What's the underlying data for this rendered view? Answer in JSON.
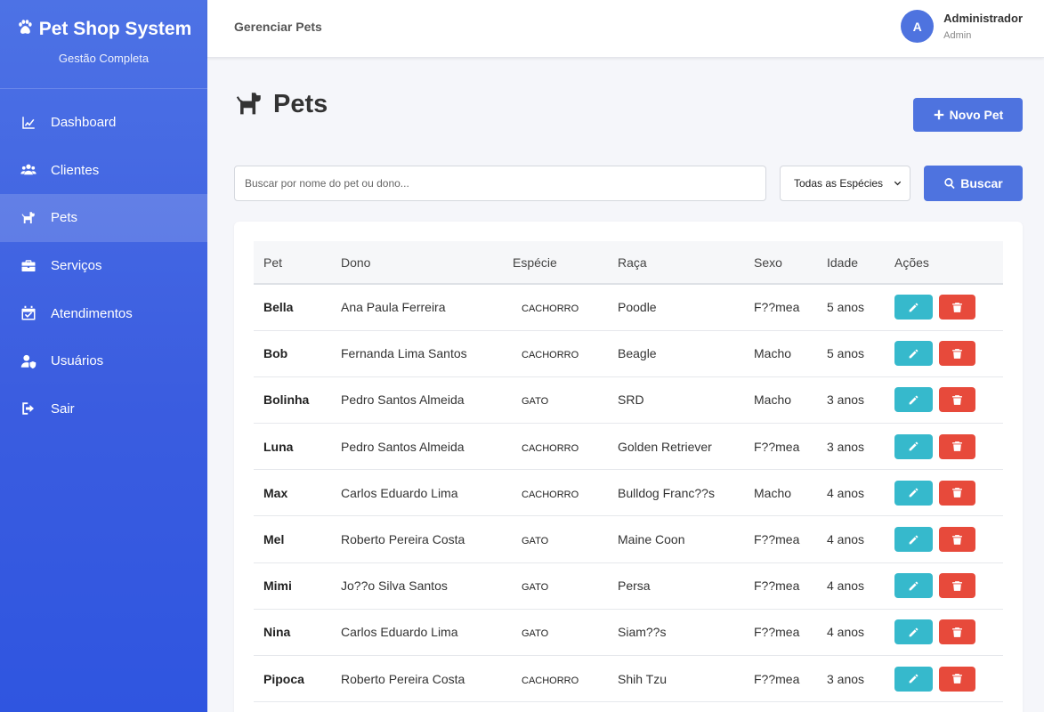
{
  "brand": {
    "title": "Pet Shop System",
    "subtitle": "Gestão Completa"
  },
  "sidebar": {
    "items": [
      {
        "label": "Dashboard",
        "icon": "chart-line-icon"
      },
      {
        "label": "Clientes",
        "icon": "users-icon"
      },
      {
        "label": "Pets",
        "icon": "dog-icon",
        "active": true
      },
      {
        "label": "Serviços",
        "icon": "briefcase-icon"
      },
      {
        "label": "Atendimentos",
        "icon": "calendar-check-icon"
      },
      {
        "label": "Usuários",
        "icon": "user-shield-icon"
      },
      {
        "label": "Sair",
        "icon": "sign-out-icon"
      }
    ]
  },
  "topbar": {
    "title": "Gerenciar Pets",
    "user": {
      "initial": "A",
      "name": "Administrador",
      "role": "Admin"
    }
  },
  "page": {
    "title": "Pets",
    "new_button": "Novo Pet"
  },
  "search": {
    "placeholder": "Buscar por nome do pet ou dono...",
    "species_selected": "Todas as Espécies",
    "button": "Buscar"
  },
  "colors": {
    "primary": "#4e73df",
    "edit": "#36b9cc",
    "delete": "#e74a3b"
  },
  "table": {
    "headers": [
      "Pet",
      "Dono",
      "Espécie",
      "Raça",
      "Sexo",
      "Idade",
      "Ações"
    ],
    "rows": [
      {
        "pet": "Bella",
        "dono": "Ana Paula Ferreira",
        "especie": "CACHORRO",
        "raca": "Poodle",
        "sexo": "F??mea",
        "idade": "5 anos"
      },
      {
        "pet": "Bob",
        "dono": "Fernanda Lima Santos",
        "especie": "CACHORRO",
        "raca": "Beagle",
        "sexo": "Macho",
        "idade": "5 anos"
      },
      {
        "pet": "Bolinha",
        "dono": "Pedro Santos Almeida",
        "especie": "GATO",
        "raca": "SRD",
        "sexo": "Macho",
        "idade": "3 anos"
      },
      {
        "pet": "Luna",
        "dono": "Pedro Santos Almeida",
        "especie": "CACHORRO",
        "raca": "Golden Retriever",
        "sexo": "F??mea",
        "idade": "3 anos"
      },
      {
        "pet": "Max",
        "dono": "Carlos Eduardo Lima",
        "especie": "CACHORRO",
        "raca": "Bulldog Franc??s",
        "sexo": "Macho",
        "idade": "4 anos"
      },
      {
        "pet": "Mel",
        "dono": "Roberto Pereira Costa",
        "especie": "GATO",
        "raca": "Maine Coon",
        "sexo": "F??mea",
        "idade": "4 anos"
      },
      {
        "pet": "Mimi",
        "dono": "Jo??o Silva Santos",
        "especie": "GATO",
        "raca": "Persa",
        "sexo": "F??mea",
        "idade": "4 anos"
      },
      {
        "pet": "Nina",
        "dono": "Carlos Eduardo Lima",
        "especie": "GATO",
        "raca": "Siam??s",
        "sexo": "F??mea",
        "idade": "4 anos"
      },
      {
        "pet": "Pipoca",
        "dono": "Roberto Pereira Costa",
        "especie": "CACHORRO",
        "raca": "Shih Tzu",
        "sexo": "F??mea",
        "idade": "3 anos"
      }
    ]
  }
}
